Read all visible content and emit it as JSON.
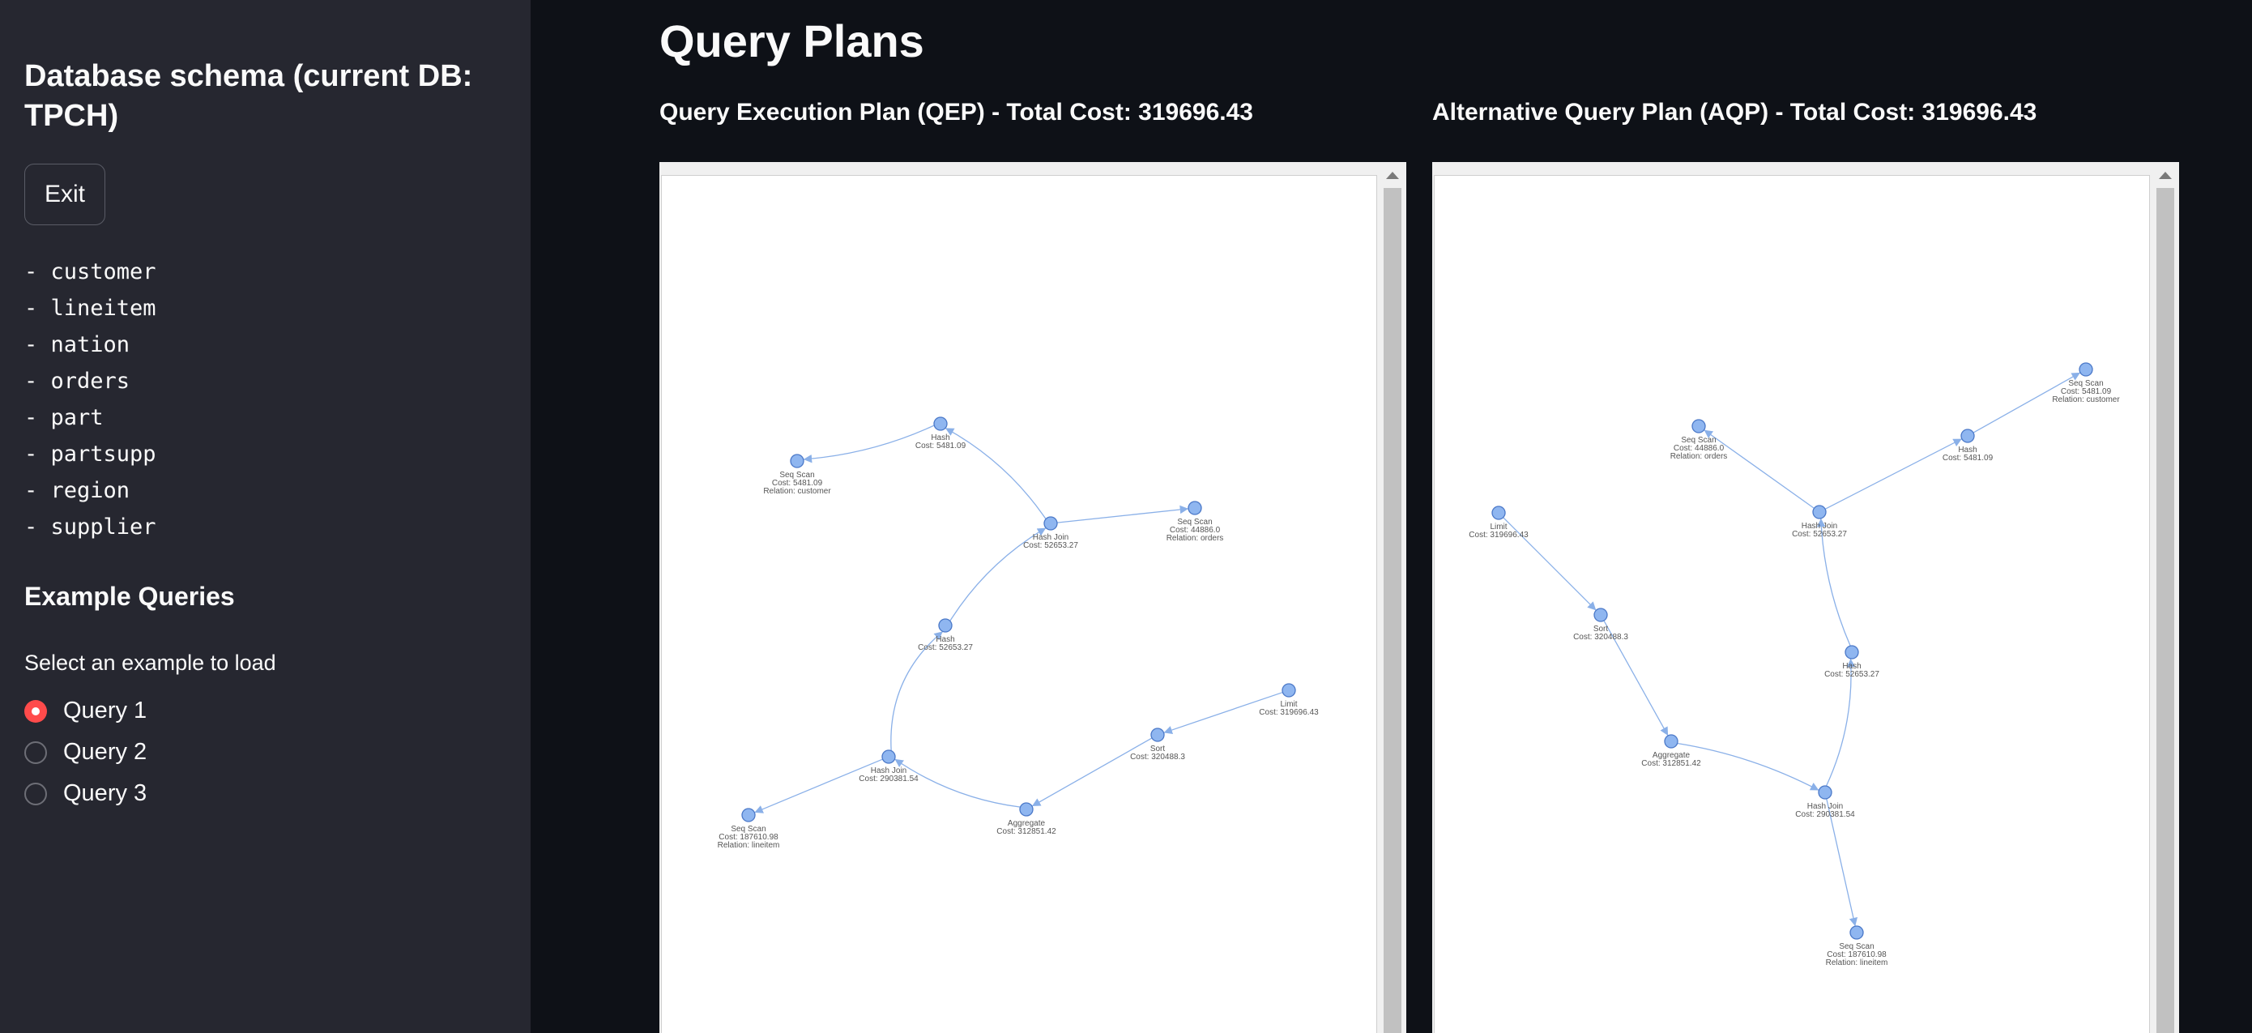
{
  "sidebar": {
    "title": "Database schema (current DB: TPCH)",
    "exit_label": "Exit",
    "tables": [
      "- customer",
      "- lineitem",
      "- nation",
      "- orders",
      "- part",
      "- partsupp",
      "- region",
      "- supplier"
    ],
    "examples_heading": "Example Queries",
    "radio_label": "Select an example to load",
    "options": [
      {
        "label": "Query 1",
        "selected": true
      },
      {
        "label": "Query 2",
        "selected": false
      },
      {
        "label": "Query 3",
        "selected": false
      }
    ]
  },
  "main": {
    "title": "Query Plans",
    "qep_title": "Query Execution Plan (QEP) - Total Cost: 319696.43",
    "aqp_title": "Alternative Query Plan (AQP) - Total Cost: 319696.43"
  },
  "colors": {
    "sidebar_bg": "#262730",
    "main_bg": "#0e1117",
    "accent": "#ff4b4b",
    "node": "#8fb6f0",
    "edge": "#8ab0e8"
  },
  "qep_graph": {
    "nodes": [
      {
        "id": "limit",
        "lines": [
          "Limit",
          "Cost: 319696.43"
        ]
      },
      {
        "id": "sort",
        "lines": [
          "Sort",
          "Cost: 320488.3"
        ]
      },
      {
        "id": "agg",
        "lines": [
          "Aggregate",
          "Cost: 312851.42"
        ]
      },
      {
        "id": "hj2",
        "lines": [
          "Hash Join",
          "Cost: 290381.54"
        ]
      },
      {
        "id": "li",
        "lines": [
          "Seq Scan",
          "Cost: 187610.98",
          "Relation: lineitem"
        ]
      },
      {
        "id": "hash2",
        "lines": [
          "Hash",
          "Cost: 52653.27"
        ]
      },
      {
        "id": "hj1",
        "lines": [
          "Hash Join",
          "Cost: 52653.27"
        ]
      },
      {
        "id": "ord",
        "lines": [
          "Seq Scan",
          "Cost: 44886.0",
          "Relation: orders"
        ]
      },
      {
        "id": "hash1",
        "lines": [
          "Hash",
          "Cost: 5481.09"
        ]
      },
      {
        "id": "cust",
        "lines": [
          "Seq Scan",
          "Cost: 5481.09",
          "Relation: customer"
        ]
      }
    ],
    "edges": [
      [
        "limit",
        "sort"
      ],
      [
        "sort",
        "agg"
      ],
      [
        "agg",
        "hj2"
      ],
      [
        "hj2",
        "li"
      ],
      [
        "hj2",
        "hash2"
      ],
      [
        "hash2",
        "hj1"
      ],
      [
        "hj1",
        "ord"
      ],
      [
        "hj1",
        "hash1"
      ],
      [
        "hash1",
        "cust"
      ]
    ]
  },
  "aqp_graph": {
    "nodes": [
      {
        "id": "limit",
        "lines": [
          "Limit",
          "Cost: 319696.43"
        ]
      },
      {
        "id": "sort",
        "lines": [
          "Sort",
          "Cost: 320488.3"
        ]
      },
      {
        "id": "agg",
        "lines": [
          "Aggregate",
          "Cost: 312851.42"
        ]
      },
      {
        "id": "hj2",
        "lines": [
          "Hash Join",
          "Cost: 290381.54"
        ]
      },
      {
        "id": "li",
        "lines": [
          "Seq Scan",
          "Cost: 187610.98",
          "Relation: lineitem"
        ]
      },
      {
        "id": "hash2",
        "lines": [
          "Hash",
          "Cost: 52653.27"
        ]
      },
      {
        "id": "hj1",
        "lines": [
          "Hash Join",
          "Cost: 52653.27"
        ]
      },
      {
        "id": "ord",
        "lines": [
          "Seq Scan",
          "Cost: 44886.0",
          "Relation: orders"
        ]
      },
      {
        "id": "hash1",
        "lines": [
          "Hash",
          "Cost: 5481.09"
        ]
      },
      {
        "id": "cust",
        "lines": [
          "Seq Scan",
          "Cost: 5481.09",
          "Relation: customer"
        ]
      }
    ],
    "edges": [
      [
        "limit",
        "sort"
      ],
      [
        "sort",
        "agg"
      ],
      [
        "agg",
        "hj2"
      ],
      [
        "hj2",
        "li"
      ],
      [
        "hj2",
        "hash2"
      ],
      [
        "hash2",
        "hj1"
      ],
      [
        "hj1",
        "ord"
      ],
      [
        "hj1",
        "hash1"
      ],
      [
        "hash1",
        "cust"
      ]
    ]
  }
}
